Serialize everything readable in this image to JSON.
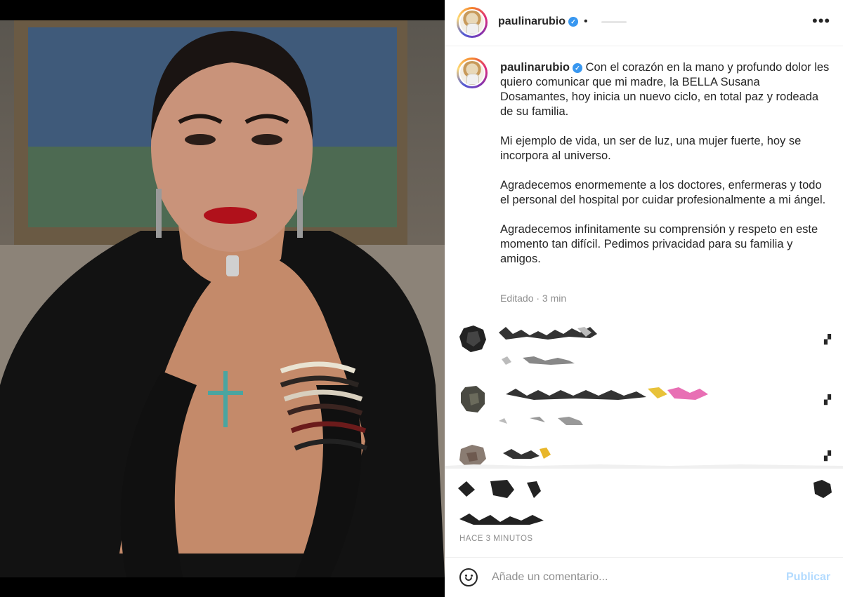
{
  "post": {
    "username": "paulinarubio",
    "verified_mark": "✓",
    "dot": "•",
    "more_label": "•••",
    "caption": {
      "username": "paulinarubio",
      "p1": "Con el corazón en la mano y profundo dolor les quiero comunicar que mi madre, la BELLA Susana Dosamantes, hoy inicia un nuevo ciclo, en total paz y rodeada de su familia.",
      "p2": "Mi ejemplo de vida, un ser de luz, una mujer fuerte, hoy se incorpora al universo.",
      "p3": "Agradecemos enormemente a los doctores, enfermeras y todo el personal del hospital por cuidar profesionalmente a mi ángel.",
      "p4": "Agradecemos infinitamente su comprensión y respeto en este momento tan difícil. Pedimos privacidad para su familia y amigos."
    },
    "meta": "Editado · 3 min",
    "timestamp": "HACE 3 MINUTOS"
  },
  "comment_box": {
    "placeholder": "Añade un comentario...",
    "publish_label": "Publicar"
  },
  "icons": {
    "emoji": "smiley-icon",
    "more": "more-options-icon",
    "verified": "verified-badge-icon"
  },
  "colors": {
    "accent_disabled": "#b3dbff",
    "verified": "#3897f0",
    "muted": "#8e8e8e"
  }
}
